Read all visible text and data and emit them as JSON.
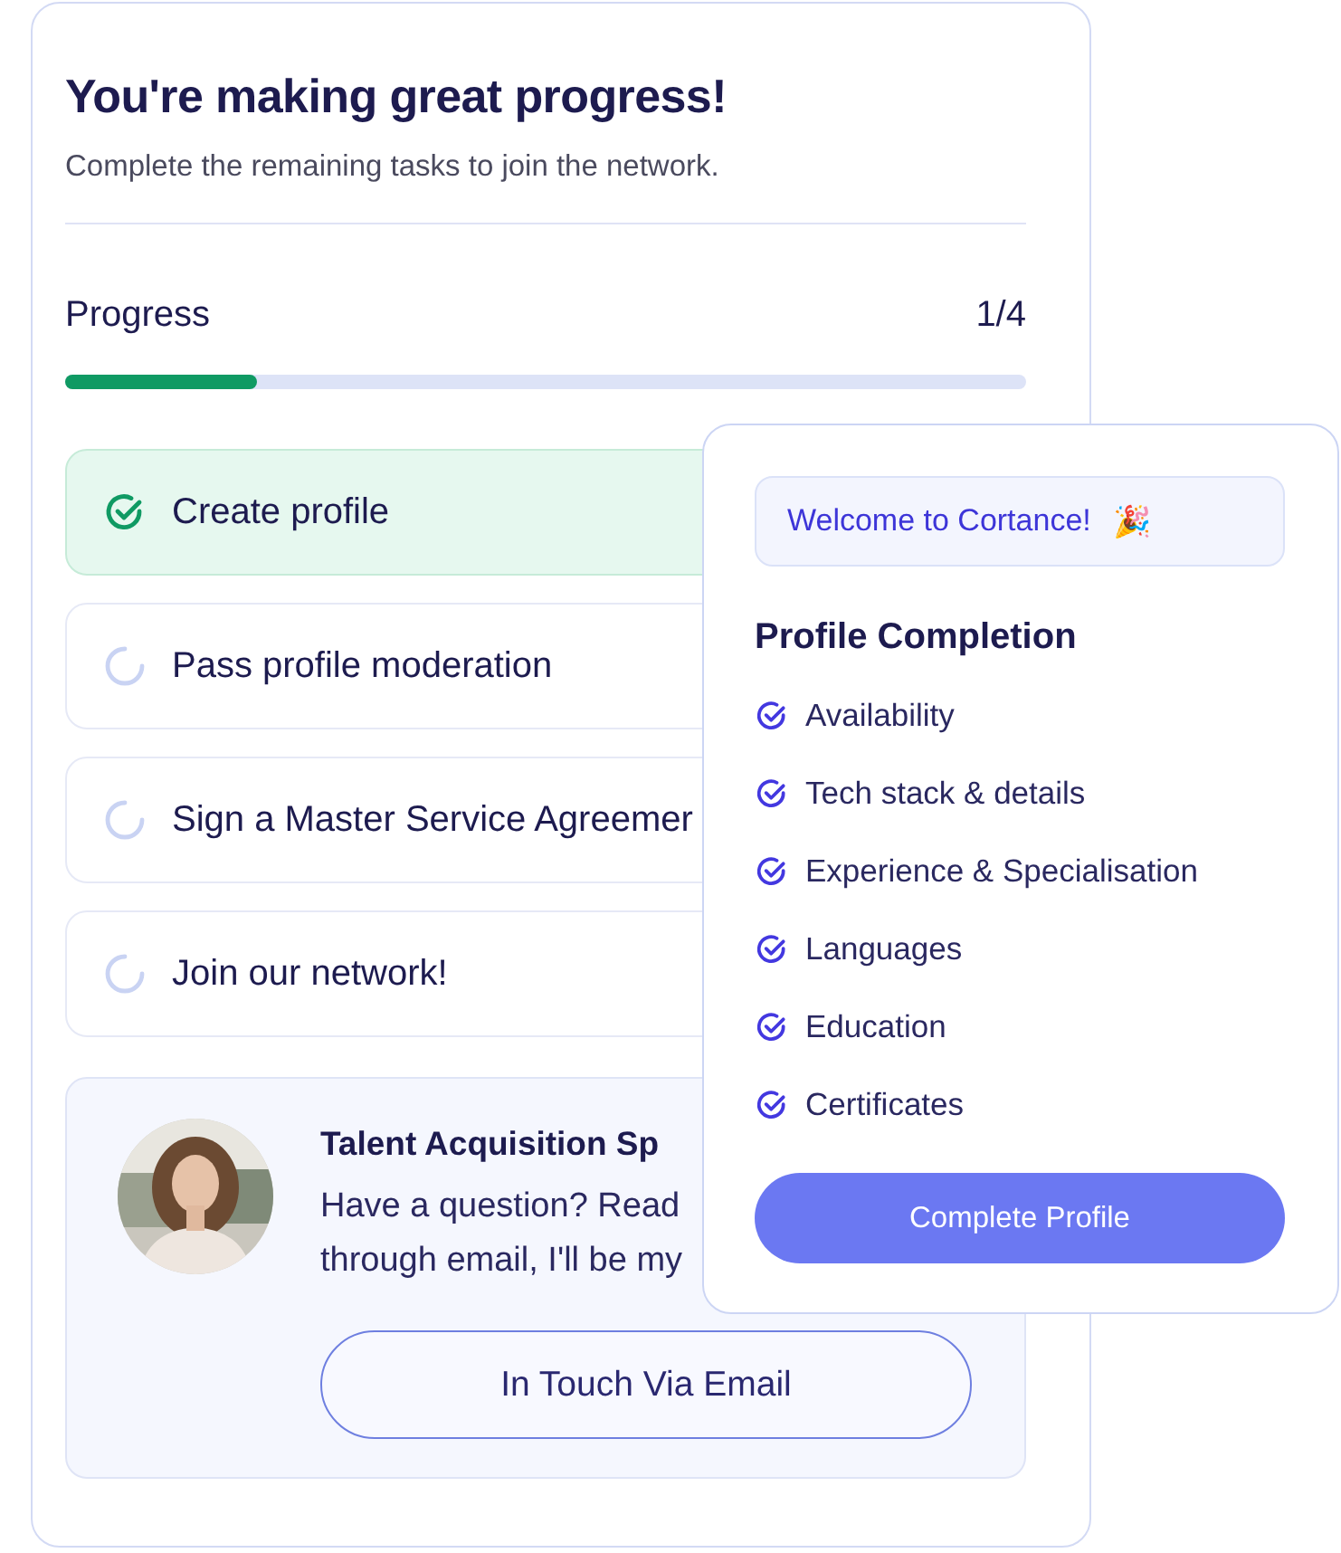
{
  "header": {
    "title": "You're making great progress!",
    "subtitle": "Complete the remaining tasks to join the network."
  },
  "progress": {
    "label": "Progress",
    "count": "1/4",
    "level": 0.2
  },
  "tasks": [
    {
      "label": "Create profile",
      "done": true
    },
    {
      "label": "Pass profile moderation",
      "done": false
    },
    {
      "label": "Sign a Master Service Agreemer",
      "done": false
    },
    {
      "label": "Join our network!",
      "done": false
    }
  ],
  "contact": {
    "title": "Talent Acquisition Sp",
    "message_lines": [
      "Have a question? Read",
      "through email, I'll be my"
    ],
    "button": "In Touch Via Email"
  },
  "profile_card": {
    "welcome": "Welcome to Cortance!",
    "welcome_emoji": "🎉",
    "title": "Profile Completion",
    "items": [
      {
        "label": "Availability",
        "checked": true
      },
      {
        "label": "Tech stack & details",
        "checked": true
      },
      {
        "label": "Experience & Specialisation",
        "checked": true
      },
      {
        "label": "Languages",
        "checked": true
      },
      {
        "label": "Education",
        "checked": true
      },
      {
        "label": "Certificates",
        "checked": true
      }
    ],
    "button": "Complete Profile"
  }
}
